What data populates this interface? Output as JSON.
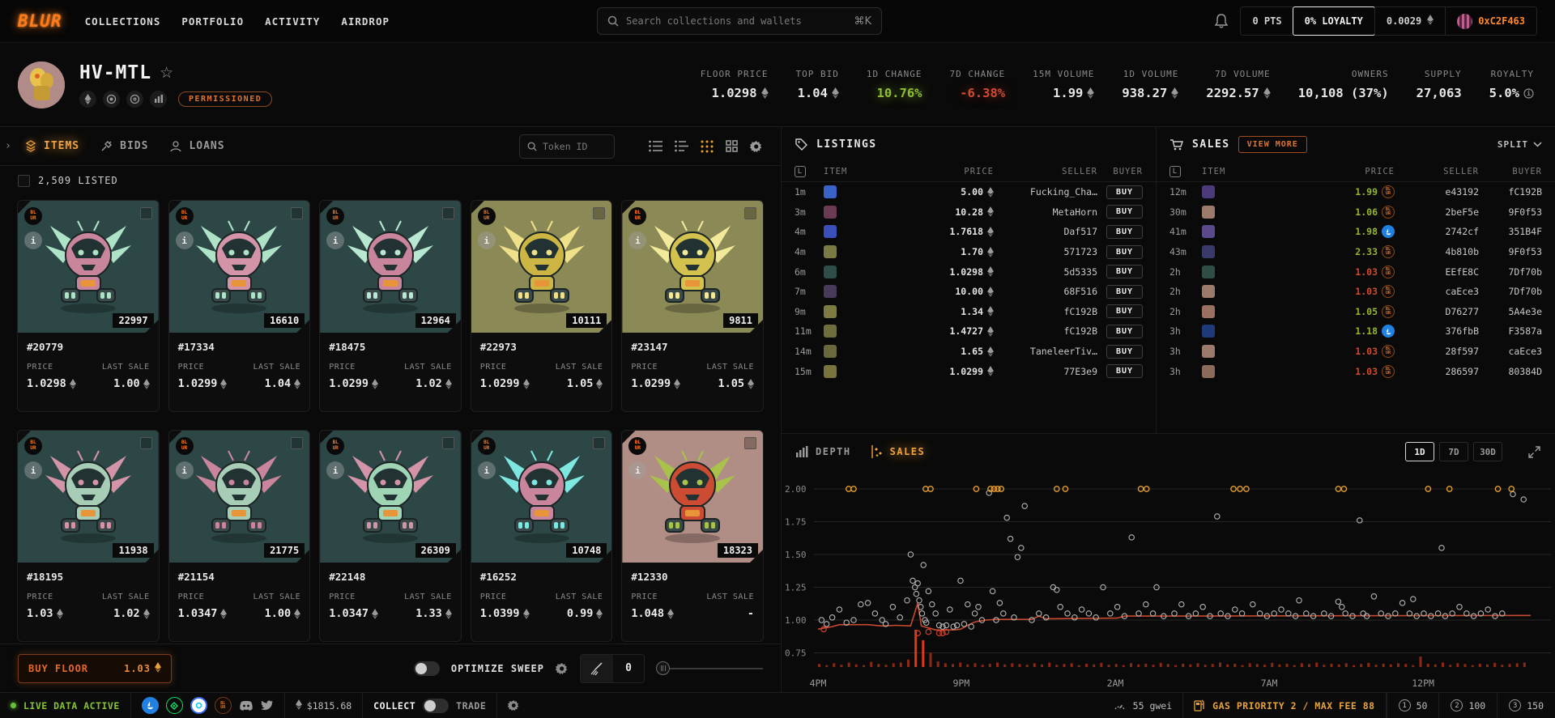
{
  "icons": {
    "eth": "eth-diamond",
    "shortcut_glyph": "⌘K",
    "star": "☆",
    "chevron": "›"
  },
  "nav": {
    "logo": "BLUR",
    "items": [
      "COLLECTIONS",
      "PORTFOLIO",
      "ACTIVITY",
      "AIRDROP"
    ],
    "search_placeholder": "Search collections and wallets",
    "pts": "0 PTS",
    "loyalty": "0% LOYALTY",
    "balance": "0.0029",
    "wallet": "0xC2F463"
  },
  "collection": {
    "name": "HV-MTL",
    "badge": "PERMISSIONED",
    "stats": [
      {
        "label": "FLOOR PRICE",
        "value": "1.0298",
        "eth": true
      },
      {
        "label": "TOP BID",
        "value": "1.04",
        "eth": true
      },
      {
        "label": "1D CHANGE",
        "value": "10.76%",
        "color": "green"
      },
      {
        "label": "7D CHANGE",
        "value": "-6.38%",
        "color": "red"
      },
      {
        "label": "15M VOLUME",
        "value": "1.99",
        "eth": true
      },
      {
        "label": "1D VOLUME",
        "value": "938.27",
        "eth": true
      },
      {
        "label": "7D VOLUME",
        "value": "2292.57",
        "eth": true
      },
      {
        "label": "OWNERS",
        "value": "10,108 (37%)"
      },
      {
        "label": "SUPPLY",
        "value": "27,063"
      },
      {
        "label": "ROYALTY",
        "value": "5.0%",
        "info": true
      }
    ]
  },
  "items_panel": {
    "tabs": [
      {
        "label": "ITEMS",
        "active": true
      },
      {
        "label": "BIDS",
        "active": false
      },
      {
        "label": "LOANS",
        "active": false
      }
    ],
    "token_search_placeholder": "Token ID",
    "listed_label": "2,509 LISTED",
    "price_label": "PRICE",
    "last_sale_label": "LAST SALE",
    "cards": [
      {
        "id": "#20779",
        "rank": "22997",
        "price": "1.0298",
        "last_sale": "1.00",
        "bg": "#2d4747",
        "main": "#c9859c",
        "accent": "#aee3c8"
      },
      {
        "id": "#17334",
        "rank": "16610",
        "price": "1.0299",
        "last_sale": "1.04",
        "bg": "#2d4747",
        "main": "#d394a8",
        "accent": "#aee3c8"
      },
      {
        "id": "#18475",
        "rank": "12964",
        "price": "1.0299",
        "last_sale": "1.02",
        "bg": "#2d4747",
        "main": "#c9859c",
        "accent": "#b8e8d2"
      },
      {
        "id": "#22973",
        "rank": "10111",
        "price": "1.0299",
        "last_sale": "1.05",
        "bg": "#8b8956",
        "main": "#cdb544",
        "accent": "#efe08a"
      },
      {
        "id": "#23147",
        "rank": "9811",
        "price": "1.0299",
        "last_sale": "1.05",
        "bg": "#8b8956",
        "main": "#d4c24e",
        "accent": "#f2ea9a"
      },
      {
        "id": "#18195",
        "rank": "11938",
        "price": "1.03",
        "last_sale": "1.02",
        "bg": "#2d4747",
        "main": "#a8cdb6",
        "accent": "#d394a8"
      },
      {
        "id": "#21154",
        "rank": "21775",
        "price": "1.0347",
        "last_sale": "1.00",
        "bg": "#2d4747",
        "main": "#a8cdb6",
        "accent": "#c9859c"
      },
      {
        "id": "#22148",
        "rank": "26309",
        "price": "1.0347",
        "last_sale": "1.33",
        "bg": "#2d4747",
        "main": "#9fd4b4",
        "accent": "#d394a8"
      },
      {
        "id": "#16252",
        "rank": "10748",
        "price": "1.0399",
        "last_sale": "0.99",
        "bg": "#2d4747",
        "main": "#c9859c",
        "accent": "#7ee8e0"
      },
      {
        "id": "#12330",
        "rank": "18323",
        "price": "1.048",
        "last_sale": "-",
        "bg": "#b18e85",
        "main": "#cc4b33",
        "accent": "#a8c24a"
      }
    ],
    "buy_floor_label": "BUY FLOOR",
    "buy_floor_price": "1.03",
    "optimize_sweep_label": "OPTIMIZE SWEEP",
    "sweep_count": "0"
  },
  "listings": {
    "title": "LISTINGS",
    "columns": {
      "item": "ITEM",
      "price": "PRICE",
      "seller": "SELLER",
      "buyer": "BUYER"
    },
    "buy_label": "BUY",
    "rows": [
      {
        "time": "1m",
        "price": "5.00",
        "seller": "Fucking_Cha…",
        "thumb": "#3a62c8"
      },
      {
        "time": "3m",
        "price": "10.28",
        "seller": "MetaHorn",
        "thumb": "#6b3a55"
      },
      {
        "time": "4m",
        "price": "1.7618",
        "seller": "Daf517",
        "thumb": "#3a50b8"
      },
      {
        "time": "4m",
        "price": "1.70",
        "seller": "571723",
        "thumb": "#7a7a45"
      },
      {
        "time": "6m",
        "price": "1.0298",
        "seller": "5d5335",
        "thumb": "#2e4d46"
      },
      {
        "time": "7m",
        "price": "10.00",
        "seller": "68F516",
        "thumb": "#4a3a5a"
      },
      {
        "time": "9m",
        "price": "1.34",
        "seller": "fC192B",
        "thumb": "#7d7a42"
      },
      {
        "time": "11m",
        "price": "1.4727",
        "seller": "fC192B",
        "thumb": "#6f6d3d"
      },
      {
        "time": "14m",
        "price": "1.65",
        "seller": "TaneleerTiv…",
        "thumb": "#6a683c"
      },
      {
        "time": "15m",
        "price": "1.0299",
        "seller": "77E3e9",
        "thumb": "#77743f"
      }
    ]
  },
  "sales": {
    "title": "SALES",
    "view_more_label": "VIEW MORE",
    "split_label": "SPLIT",
    "columns": {
      "item": "ITEM",
      "price": "PRICE",
      "seller": "SELLER",
      "buyer": "BUYER"
    },
    "rows": [
      {
        "time": "12m",
        "price": "1.99",
        "dir": "up",
        "market": "blur",
        "seller": "e43192",
        "buyer": "fC192B",
        "thumb": "#4a3a7a"
      },
      {
        "time": "30m",
        "price": "1.06",
        "dir": "up",
        "market": "blur",
        "seller": "2beF5e",
        "buyer": "9F0f53",
        "thumb": "#9a7a6a"
      },
      {
        "time": "41m",
        "price": "1.98",
        "dir": "up",
        "market": "opensea",
        "seller": "2742cf",
        "buyer": "351B4F",
        "thumb": "#5a4a8a"
      },
      {
        "time": "43m",
        "price": "2.33",
        "dir": "up",
        "market": "blur",
        "seller": "4b810b",
        "buyer": "9F0f53",
        "thumb": "#3a3a6a"
      },
      {
        "time": "2h",
        "price": "1.03",
        "dir": "down",
        "market": "blur",
        "seller": "EEfE8C",
        "buyer": "7Df70b",
        "thumb": "#2e4d46"
      },
      {
        "time": "2h",
        "price": "1.03",
        "dir": "down",
        "market": "blur",
        "seller": "caEce3",
        "buyer": "7Df70b",
        "thumb": "#9a7a6a"
      },
      {
        "time": "2h",
        "price": "1.05",
        "dir": "up",
        "market": "blur",
        "seller": "D76277",
        "buyer": "5A4e3e",
        "thumb": "#9a7060"
      },
      {
        "time": "3h",
        "price": "1.18",
        "dir": "up",
        "market": "opensea",
        "seller": "376fbB",
        "buyer": "F3587a",
        "thumb": "#1e3a7a"
      },
      {
        "time": "3h",
        "price": "1.03",
        "dir": "down",
        "market": "blur",
        "seller": "28f597",
        "buyer": "caEce3",
        "thumb": "#9a7a6a"
      },
      {
        "time": "3h",
        "price": "1.03",
        "dir": "down",
        "market": "blur",
        "seller": "286597",
        "buyer": "80384D",
        "thumb": "#8a6a5a"
      }
    ]
  },
  "chart_data": {
    "type": "scatter",
    "tabs": [
      {
        "label": "DEPTH",
        "active": false
      },
      {
        "label": "SALES",
        "active": true
      }
    ],
    "range_buttons": [
      {
        "label": "1D",
        "active": true
      },
      {
        "label": "7D",
        "active": false
      },
      {
        "label": "30D",
        "active": false
      }
    ],
    "ylim": [
      0.75,
      2.0
    ],
    "y_ticks": [
      "2.00",
      "1.75",
      "1.50",
      "1.25",
      "1.00",
      "0.75"
    ],
    "x_ticks": [
      "4PM",
      "9PM",
      "2AM",
      "7AM",
      "12PM"
    ],
    "x_tick_pos": [
      0.0,
      0.201,
      0.417,
      0.633,
      0.849
    ],
    "capped_price": 2.0,
    "points_capped_x": [
      0.043,
      0.05,
      0.151,
      0.158,
      0.222,
      0.242,
      0.247,
      0.252,
      0.257,
      0.335,
      0.347,
      0.453,
      0.461,
      0.583,
      0.592,
      0.601,
      0.73,
      0.738,
      0.856,
      0.886,
      0.954,
      0.973
    ],
    "points_grey": [
      [
        0.005,
        1.0
      ],
      [
        0.012,
        0.97
      ],
      [
        0.02,
        1.02
      ],
      [
        0.03,
        1.08
      ],
      [
        0.04,
        0.98
      ],
      [
        0.05,
        1.0
      ],
      [
        0.06,
        1.12
      ],
      [
        0.07,
        1.13
      ],
      [
        0.08,
        1.05
      ],
      [
        0.09,
        1.0
      ],
      [
        0.095,
        0.97
      ],
      [
        0.105,
        1.1
      ],
      [
        0.115,
        1.02
      ],
      [
        0.125,
        1.15
      ],
      [
        0.13,
        1.5
      ],
      [
        0.133,
        1.3
      ],
      [
        0.136,
        1.25
      ],
      [
        0.138,
        1.2
      ],
      [
        0.14,
        1.28
      ],
      [
        0.142,
        1.15
      ],
      [
        0.144,
        1.1
      ],
      [
        0.146,
        1.05
      ],
      [
        0.148,
        1.42
      ],
      [
        0.15,
        1.0
      ],
      [
        0.152,
        0.98
      ],
      [
        0.155,
        1.22
      ],
      [
        0.16,
        1.12
      ],
      [
        0.165,
        1.05
      ],
      [
        0.17,
        0.96
      ],
      [
        0.175,
        0.95
      ],
      [
        0.18,
        0.96
      ],
      [
        0.185,
        1.08
      ],
      [
        0.19,
        0.95
      ],
      [
        0.195,
        0.96
      ],
      [
        0.2,
        1.3
      ],
      [
        0.205,
        0.97
      ],
      [
        0.21,
        1.12
      ],
      [
        0.215,
        0.95
      ],
      [
        0.22,
        1.05
      ],
      [
        0.225,
        1.1
      ],
      [
        0.23,
        1.0
      ],
      [
        0.24,
        1.97
      ],
      [
        0.245,
        1.22
      ],
      [
        0.25,
        1.0
      ],
      [
        0.255,
        1.13
      ],
      [
        0.26,
        1.05
      ],
      [
        0.265,
        1.78
      ],
      [
        0.27,
        1.62
      ],
      [
        0.275,
        1.02
      ],
      [
        0.28,
        1.48
      ],
      [
        0.285,
        1.55
      ],
      [
        0.29,
        1.87
      ],
      [
        0.3,
        1.0
      ],
      [
        0.31,
        1.05
      ],
      [
        0.32,
        1.02
      ],
      [
        0.33,
        1.25
      ],
      [
        0.335,
        1.23
      ],
      [
        0.34,
        1.1
      ],
      [
        0.35,
        1.05
      ],
      [
        0.36,
        1.02
      ],
      [
        0.37,
        1.08
      ],
      [
        0.38,
        1.05
      ],
      [
        0.39,
        1.02
      ],
      [
        0.4,
        1.25
      ],
      [
        0.41,
        1.05
      ],
      [
        0.42,
        1.1
      ],
      [
        0.43,
        1.03
      ],
      [
        0.44,
        1.63
      ],
      [
        0.45,
        1.05
      ],
      [
        0.46,
        1.12
      ],
      [
        0.47,
        1.05
      ],
      [
        0.475,
        1.25
      ],
      [
        0.485,
        1.03
      ],
      [
        0.5,
        1.05
      ],
      [
        0.51,
        1.12
      ],
      [
        0.52,
        1.03
      ],
      [
        0.53,
        1.05
      ],
      [
        0.54,
        1.1
      ],
      [
        0.55,
        1.03
      ],
      [
        0.56,
        1.79
      ],
      [
        0.565,
        1.05
      ],
      [
        0.575,
        1.03
      ],
      [
        0.585,
        1.08
      ],
      [
        0.595,
        1.05
      ],
      [
        0.61,
        1.12
      ],
      [
        0.62,
        1.05
      ],
      [
        0.63,
        1.03
      ],
      [
        0.64,
        1.05
      ],
      [
        0.65,
        1.08
      ],
      [
        0.66,
        1.05
      ],
      [
        0.67,
        1.03
      ],
      [
        0.675,
        1.15
      ],
      [
        0.685,
        1.05
      ],
      [
        0.695,
        1.03
      ],
      [
        0.71,
        1.05
      ],
      [
        0.72,
        1.03
      ],
      [
        0.73,
        1.14
      ],
      [
        0.735,
        1.1
      ],
      [
        0.74,
        1.05
      ],
      [
        0.75,
        1.03
      ],
      [
        0.76,
        1.76
      ],
      [
        0.765,
        1.05
      ],
      [
        0.77,
        1.03
      ],
      [
        0.78,
        1.18
      ],
      [
        0.79,
        1.05
      ],
      [
        0.8,
        1.03
      ],
      [
        0.81,
        1.05
      ],
      [
        0.82,
        1.13
      ],
      [
        0.83,
        1.05
      ],
      [
        0.835,
        1.16
      ],
      [
        0.84,
        1.03
      ],
      [
        0.85,
        1.05
      ],
      [
        0.86,
        1.03
      ],
      [
        0.87,
        1.05
      ],
      [
        0.875,
        1.55
      ],
      [
        0.88,
        1.03
      ],
      [
        0.89,
        1.05
      ],
      [
        0.9,
        1.1
      ],
      [
        0.91,
        1.05
      ],
      [
        0.92,
        1.03
      ],
      [
        0.93,
        1.05
      ],
      [
        0.94,
        1.08
      ],
      [
        0.95,
        1.03
      ],
      [
        0.96,
        1.05
      ],
      [
        0.975,
        1.96
      ],
      [
        0.99,
        1.92
      ]
    ],
    "points_red": [
      [
        0.008,
        0.93
      ],
      [
        0.14,
        0.9
      ],
      [
        0.155,
        0.91
      ],
      [
        0.17,
        0.9
      ],
      [
        0.175,
        0.9
      ],
      [
        0.18,
        0.91
      ]
    ],
    "floor_line": [
      [
        0,
        0.93
      ],
      [
        0.02,
        0.95
      ],
      [
        0.03,
        0.965
      ],
      [
        0.07,
        0.965
      ],
      [
        0.09,
        0.955
      ],
      [
        0.11,
        0.96
      ],
      [
        0.13,
        0.955
      ],
      [
        0.14,
        1.13
      ],
      [
        0.145,
        0.955
      ],
      [
        0.155,
        0.94
      ],
      [
        0.165,
        0.925
      ],
      [
        0.19,
        0.925
      ],
      [
        0.2,
        0.93
      ],
      [
        0.21,
        0.96
      ],
      [
        0.22,
        0.985
      ],
      [
        0.235,
        1.0
      ],
      [
        0.25,
        1.005
      ],
      [
        0.3,
        1.005
      ],
      [
        0.31,
        1.03
      ],
      [
        0.32,
        1.01
      ],
      [
        0.42,
        1.015
      ],
      [
        0.43,
        1.03
      ],
      [
        0.5,
        1.03
      ],
      [
        1,
        1.035
      ]
    ],
    "volume_bars": [
      0.08,
      0.05,
      0.1,
      0.06,
      0.12,
      0.07,
      0.05,
      0.14,
      0.08,
      0.06,
      0.1,
      0.12,
      0.2,
      1.0,
      0.72,
      0.38,
      0.15,
      0.1,
      0.08,
      0.12,
      0.07,
      0.1,
      0.06,
      0.09,
      0.12,
      0.07,
      0.1,
      0.08,
      0.06,
      0.1,
      0.07,
      0.12,
      0.06,
      0.08,
      0.1,
      0.05,
      0.09,
      0.07,
      0.11,
      0.06,
      0.08,
      0.05,
      0.1,
      0.07,
      0.09,
      0.06,
      0.11,
      0.08,
      0.05,
      0.09,
      0.07,
      0.1,
      0.06,
      0.08,
      0.12,
      0.07,
      0.09,
      0.05,
      0.1,
      0.08,
      0.06,
      0.11,
      0.07,
      0.09,
      0.05,
      0.1,
      0.08,
      0.12,
      0.06,
      0.09,
      0.07,
      0.1,
      0.05,
      0.08,
      0.11,
      0.06,
      0.09,
      0.07,
      0.1,
      0.08,
      0.05,
      0.28,
      0.09,
      0.07,
      0.12,
      0.06,
      0.1,
      0.08,
      0.05,
      0.09,
      0.07,
      0.11,
      0.06,
      0.08,
      0.1,
      0.12
    ]
  },
  "status_bar": {
    "live_label": "LIVE DATA ACTIVE",
    "eth_usd": "$1815.68",
    "collect_label": "COLLECT",
    "trade_label": "TRADE",
    "gwei_label": "55 gwei",
    "gas_label": "GAS PRIORITY 2 / MAX FEE 88",
    "presets": [
      {
        "num": "1",
        "value": "50"
      },
      {
        "num": "2",
        "value": "100"
      },
      {
        "num": "3",
        "value": "150"
      }
    ]
  }
}
